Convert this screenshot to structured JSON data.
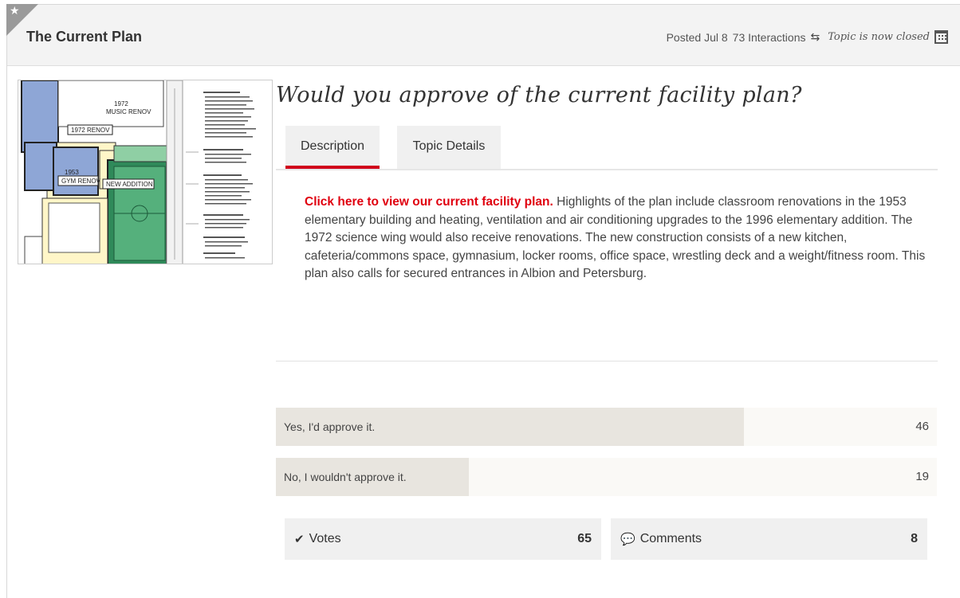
{
  "topic": {
    "title": "The Current Plan",
    "posted": "Posted Jul 8",
    "interactions": "73 Interactions",
    "status": "Topic is now closed",
    "icons": {
      "corner": "star-icon",
      "interactions": "swap-arrows-icon",
      "status": "calendar-icon"
    }
  },
  "question": "Would you approve of the current facility plan?",
  "tabs": [
    {
      "label": "Description",
      "active": true
    },
    {
      "label": "Topic Details",
      "active": false
    }
  ],
  "description": {
    "link_text": "Click here to view our current facility plan.",
    "body": " Highlights of the plan include classroom renovations in the 1953 elementary building and heating, ventilation and air conditioning upgrades to the 1996 elementary addition. The 1972 science wing would also receive renovations. The new construction consists of a new kitchen, cafeteria/commons space, gymnasium, locker rooms, office space, wrestling deck and a weight/fitness room. This plan also calls for secured entrances in Albion and Petersburg."
  },
  "thumbnail": {
    "labels": {
      "music": "1972\nMUSIC RENOV",
      "reno1972": "1972 RENOV",
      "gym1953a": "1953",
      "gym1953b": "GYM RENOV",
      "addition": "NEW ADDITION"
    }
  },
  "poll": {
    "total": 65,
    "options": [
      {
        "label": "Yes, I'd approve it.",
        "count": 46,
        "share": 0.708
      },
      {
        "label": "No, I wouldn't approve it.",
        "count": 19,
        "share": 0.292
      }
    ]
  },
  "stats": {
    "votes_label": "Votes",
    "votes_count": "65",
    "comments_label": "Comments",
    "comments_count": "8"
  },
  "colors": {
    "accent": "#d0021b",
    "link": "#e0000f",
    "poll_fill": "#e8e5df"
  }
}
